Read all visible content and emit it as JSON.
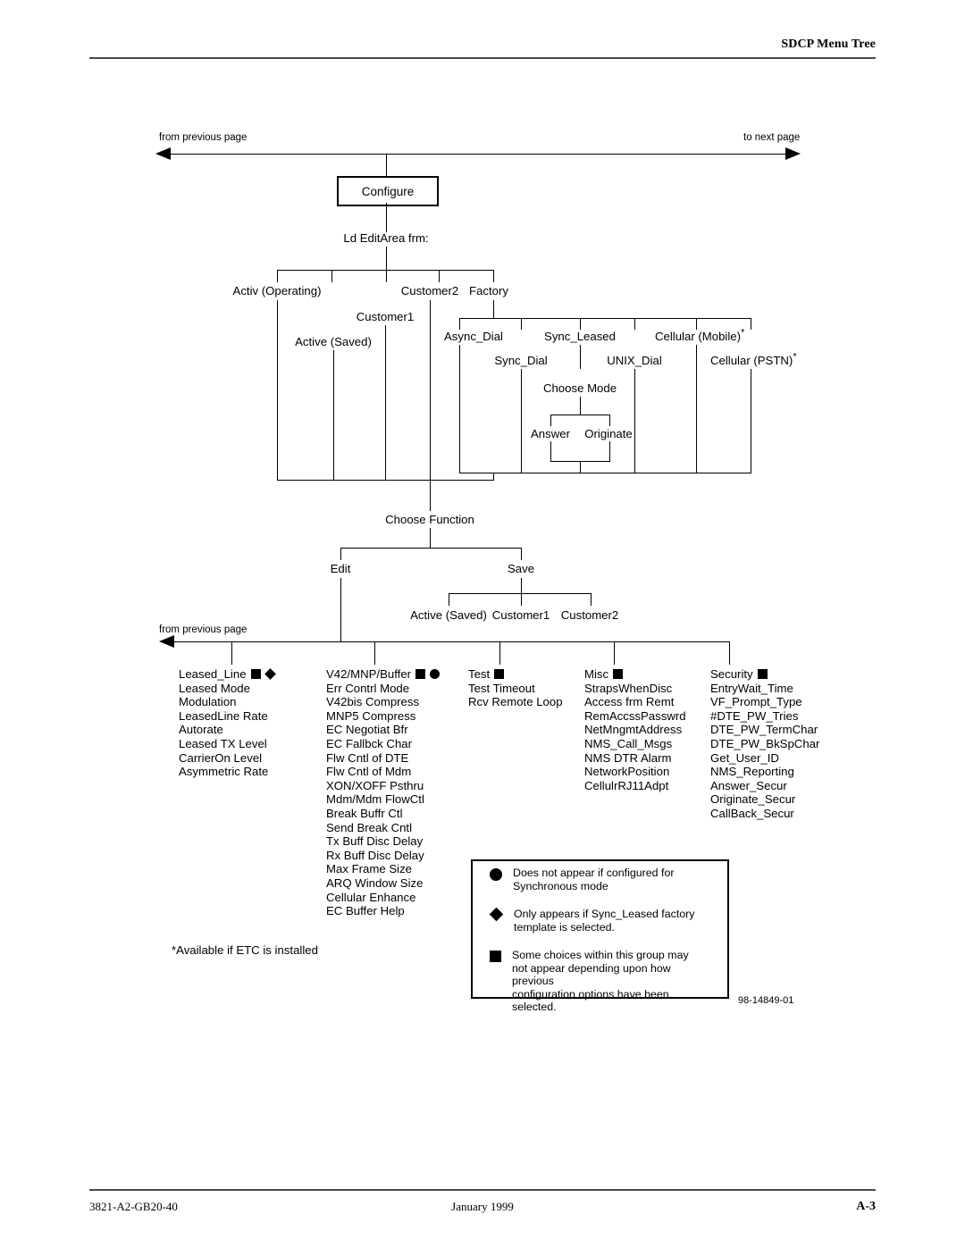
{
  "header": {
    "title": "SDCP Menu Tree"
  },
  "footer": {
    "doc_number": "3821-A2-GB20-40",
    "date": "January 1999",
    "page_number": "A-3"
  },
  "figure_number": "98-14849-01",
  "footnote": "*Available if ETC is installed",
  "connectors": {
    "from_previous_page_top": "from previous page",
    "to_next_page": "to next page",
    "from_previous_page_bottom": "from previous page"
  },
  "diagram": {
    "root_box": "Configure",
    "load_prompt": "Ld EditArea frm:",
    "edit_area_options": [
      "Activ (Operating)",
      "Active (Saved)",
      "Customer1",
      "Customer2",
      "Factory"
    ],
    "factory_templates": [
      "Async_Dial",
      "Sync_Dial",
      "Sync_Leased",
      "UNIX_Dial",
      "Cellular (Mobile)",
      "Cellular (PSTN)"
    ],
    "factory_templates_asterisk": [
      "Cellular (Mobile)",
      "Cellular (PSTN)"
    ],
    "choose_mode": {
      "label": "Choose Mode",
      "options": [
        "Answer",
        "Originate"
      ]
    },
    "choose_function": {
      "label": "Choose Function",
      "options": [
        "Edit",
        "Save"
      ]
    },
    "save_targets": [
      "Active (Saved)",
      "Customer1",
      "Customer2"
    ]
  },
  "edit_groups": [
    {
      "name": "Leased_Line",
      "symbols": [
        "square",
        "diamond"
      ],
      "items": [
        "Leased Mode",
        "Modulation",
        "LeasedLine Rate",
        "Autorate",
        "Leased TX Level",
        "CarrierOn Level",
        "Asymmetric Rate"
      ]
    },
    {
      "name": "V42/MNP/Buffer",
      "symbols": [
        "square",
        "circle"
      ],
      "items": [
        "Err Contrl Mode",
        "V42bis Compress",
        "MNP5 Compress",
        "EC Negotiat Bfr",
        "EC Fallbck Char",
        "Flw Cntl of DTE",
        "Flw Cntl of Mdm",
        "XON/XOFF Psthru",
        "Mdm/Mdm FlowCtl",
        "Break Buffr Ctl",
        "Send Break Cntl",
        "Tx Buff Disc Delay",
        "Rx Buff Disc Delay",
        "Max Frame Size",
        "ARQ Window Size",
        "Cellular Enhance",
        "EC Buffer Help"
      ]
    },
    {
      "name": "Test",
      "symbols": [
        "square"
      ],
      "items": [
        "Test Timeout",
        "Rcv Remote Loop"
      ]
    },
    {
      "name": "Misc",
      "symbols": [
        "square"
      ],
      "items": [
        "StrapsWhenDisc",
        "Access frm Remt",
        "RemAccssPasswrd",
        "NetMngmtAddress",
        "NMS_Call_Msgs",
        "NMS DTR Alarm",
        "NetworkPosition",
        "CellulrRJ11Adpt"
      ]
    },
    {
      "name": "Security",
      "symbols": [
        "square"
      ],
      "items": [
        "EntryWait_Time",
        "VF_Prompt_Type",
        "#DTE_PW_Tries",
        "DTE_PW_TermChar",
        "DTE_PW_BkSpChar",
        "Get_User_ID",
        "NMS_Reporting",
        "Answer_Secur",
        "Originate_Secur",
        "CallBack_Secur"
      ]
    }
  ],
  "legend": [
    {
      "symbol": "circle",
      "text": "Does not appear if configured for\nSynchronous mode"
    },
    {
      "symbol": "diamond",
      "text": "Only appears if Sync_Leased factory\ntemplate is selected."
    },
    {
      "symbol": "square",
      "text": "Some choices within this group may\nnot appear depending upon how previous\nconfiguration options have been selected."
    }
  ]
}
